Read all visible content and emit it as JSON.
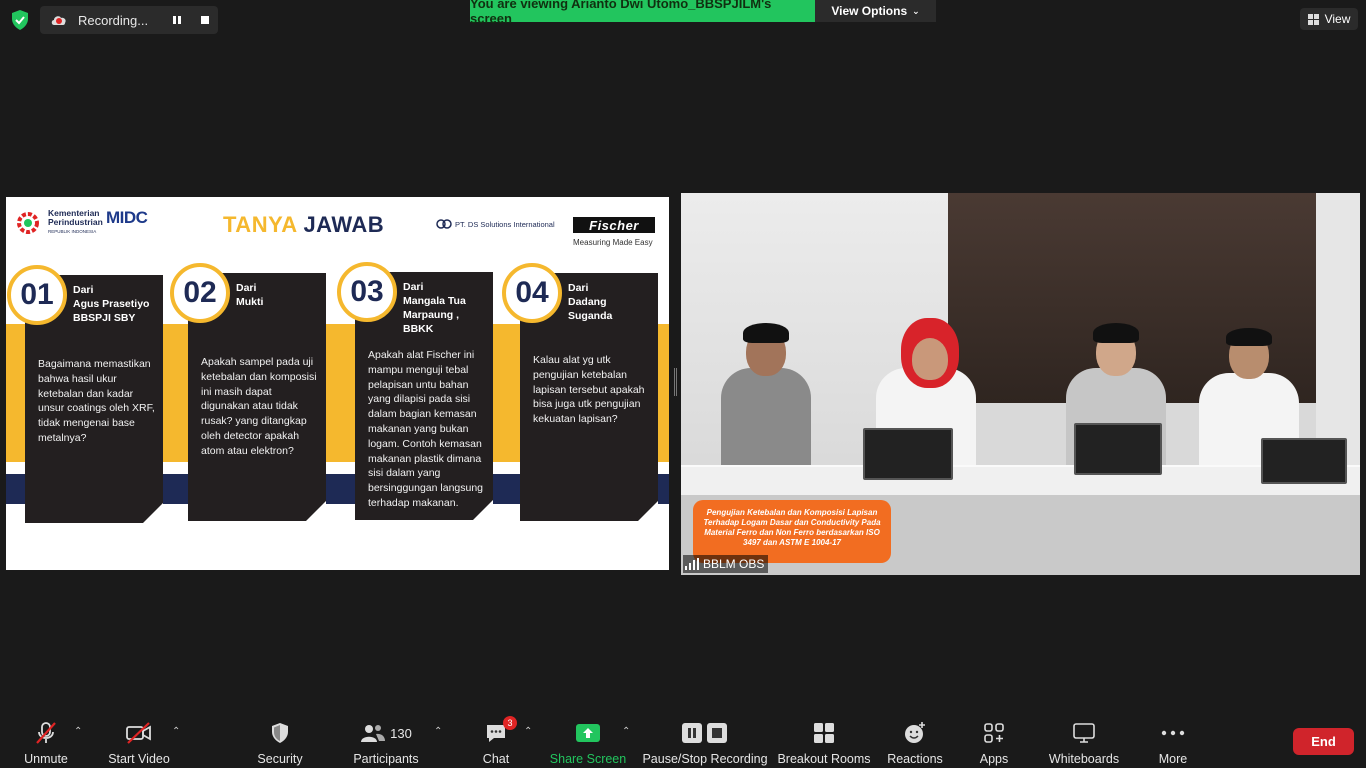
{
  "top_bar": {
    "recording_label": "Recording...",
    "viewing_banner": "You are viewing Arianto Dwi Utomo_BBSPJILM's screen",
    "view_options_label": "View Options",
    "view_label": "View"
  },
  "slide": {
    "title_part1": "TANYA",
    "title_part2": "JAWAB",
    "logo_kemenperin_line1": "Kementerian",
    "logo_kemenperin_line2": "Perindustrian",
    "logo_kemenperin_sub": "REPUBLIK INDONESIA",
    "logo_midc": "MIDC",
    "logo_ds": "PT. DS Solutions International",
    "logo_fischer": "Fischer",
    "fischer_tagline": "Measuring Made Easy",
    "cards": [
      {
        "number": "01",
        "from": "Dari\nAgus Prasetiyo\nBBSPJI SBY",
        "question": "Bagaimana memastikan bahwa hasil ukur ketebalan dan kadar unsur coatings oleh XRF, tidak mengenai base metalnya?"
      },
      {
        "number": "02",
        "from": "Dari\nMukti",
        "question": "Apakah sampel pada uji ketebalan dan komposisi ini masih dapat digunakan atau tidak rusak? yang ditangkap oleh detector apakah atom atau elektron?"
      },
      {
        "number": "03",
        "from": "Dari\nMangala Tua Marpaung ,\nBBKK",
        "question": "Apakah alat Fischer ini mampu menguji tebal pelapisan  untu bahan yang dilapisi pada sisi dalam bagian kemasan makanan yang bukan logam.  Contoh kemasan makanan plastik dimana sisi dalam yang bersinggungan langsung terhadap makanan."
      },
      {
        "number": "04",
        "from": "Dari\nDadang\nSuganda",
        "question": "Kalau alat yg utk pengujian ketebalan lapisan tersebut apakah bisa juga utk pengujian kekuatan lapisan?"
      }
    ]
  },
  "video": {
    "lower_third": "Pengujian Ketebalan dan Komposisi Lapisan Terhadap Logam Dasar dan Conductivity Pada Material Ferro dan Non Ferro berdasarkan ISO 3497 dan  ASTM E 1004-17",
    "participant_name": "BBLM OBS"
  },
  "toolbar": {
    "unmute": "Unmute",
    "start_video": "Start Video",
    "security": "Security",
    "participants": "Participants",
    "participants_count": "130",
    "chat": "Chat",
    "chat_badge": "3",
    "share_screen": "Share Screen",
    "pause_stop_recording": "Pause/Stop Recording",
    "breakout_rooms": "Breakout Rooms",
    "reactions": "Reactions",
    "apps": "Apps",
    "whiteboards": "Whiteboards",
    "more": "More",
    "end": "End"
  },
  "colors": {
    "accent_green": "#22c55e",
    "end_red": "#d0242b",
    "slide_yellow": "#f5b82e",
    "slide_navy": "#1e2a55",
    "lower_third_orange": "#f26d21"
  }
}
